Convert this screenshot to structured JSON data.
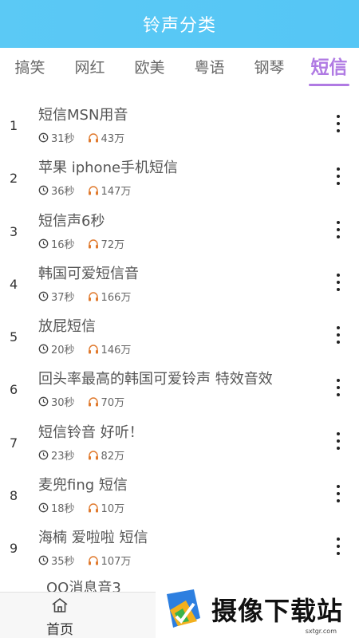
{
  "header": {
    "title": "铃声分类"
  },
  "tabs": [
    {
      "label": "搞笑",
      "active": false
    },
    {
      "label": "网红",
      "active": false
    },
    {
      "label": "欧美",
      "active": false
    },
    {
      "label": "粤语",
      "active": false
    },
    {
      "label": "钢琴",
      "active": false
    },
    {
      "label": "短信",
      "active": true
    }
  ],
  "colors": {
    "header": "#5bc9f5",
    "active_tab": "#b07ae3",
    "headphone_icon": "#e07a2e"
  },
  "icons": {
    "duration": "clock-icon",
    "plays": "headphones-icon",
    "more": "more-vertical-icon",
    "home": "home-icon"
  },
  "rows": [
    {
      "num": "1",
      "name": "短信MSN用音",
      "duration": "31秒",
      "plays": "43万"
    },
    {
      "num": "2",
      "name": "苹果 iphone手机短信",
      "duration": "36秒",
      "plays": "147万"
    },
    {
      "num": "3",
      "name": "短信声6秒",
      "duration": "16秒",
      "plays": "72万"
    },
    {
      "num": "4",
      "name": "韩国可爱短信音",
      "duration": "37秒",
      "plays": "166万"
    },
    {
      "num": "5",
      "name": "放屁短信",
      "duration": "20秒",
      "plays": "146万"
    },
    {
      "num": "6",
      "name": "回头率最高的韩国可爱铃声 特效音效",
      "duration": "30秒",
      "plays": "70万"
    },
    {
      "num": "7",
      "name": "短信铃音 好听！",
      "duration": "23秒",
      "plays": "82万"
    },
    {
      "num": "8",
      "name": "麦兜fing 短信",
      "duration": "18秒",
      "plays": "10万"
    },
    {
      "num": "9",
      "name": "海楠 爱啦啦 短信",
      "duration": "35秒",
      "plays": "107万"
    }
  ],
  "partial_row": {
    "name": "QQ消息音3"
  },
  "bottom_nav": {
    "home_label": "首页"
  },
  "watermark": {
    "text": "摄像下载站",
    "url": "sxtgr.com"
  }
}
